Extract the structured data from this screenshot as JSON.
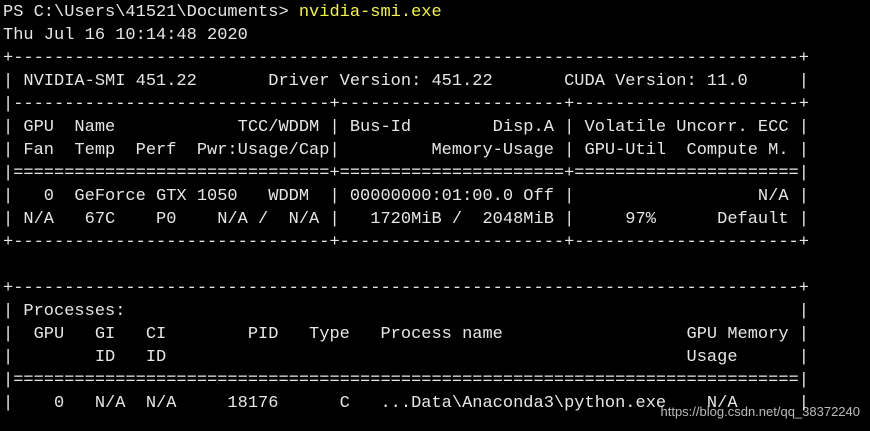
{
  "prompt": {
    "prefix": "PS C:\\Users\\41521\\Documents> ",
    "command": "nvidia-smi.exe"
  },
  "lines": [
    "Thu Jul 16 10:14:48 2020",
    "+-----------------------------------------------------------------------------+",
    "| NVIDIA-SMI 451.22       Driver Version: 451.22       CUDA Version: 11.0     |",
    "|-------------------------------+----------------------+----------------------+",
    "| GPU  Name            TCC/WDDM | Bus-Id        Disp.A | Volatile Uncorr. ECC |",
    "| Fan  Temp  Perf  Pwr:Usage/Cap|         Memory-Usage | GPU-Util  Compute M. |",
    "|===============================+======================+======================|",
    "|   0  GeForce GTX 1050   WDDM  | 00000000:01:00.0 Off |                  N/A |",
    "| N/A   67C    P0    N/A /  N/A |   1720MiB /  2048MiB |     97%      Default |",
    "+-------------------------------+----------------------+----------------------+",
    "",
    "+-----------------------------------------------------------------------------+",
    "| Processes:                                                                  |",
    "|  GPU   GI   CI        PID   Type   Process name                  GPU Memory |",
    "|        ID   ID                                                   Usage      |",
    "|=============================================================================|",
    "|    0   N/A  N/A     18176      C   ...Data\\Anaconda3\\python.exe    N/A      |"
  ],
  "watermark": "https://blog.csdn.net/qq_38372240",
  "colors": {
    "background": "#000000",
    "text": "#e6e6e6",
    "command": "#f2f24e"
  }
}
